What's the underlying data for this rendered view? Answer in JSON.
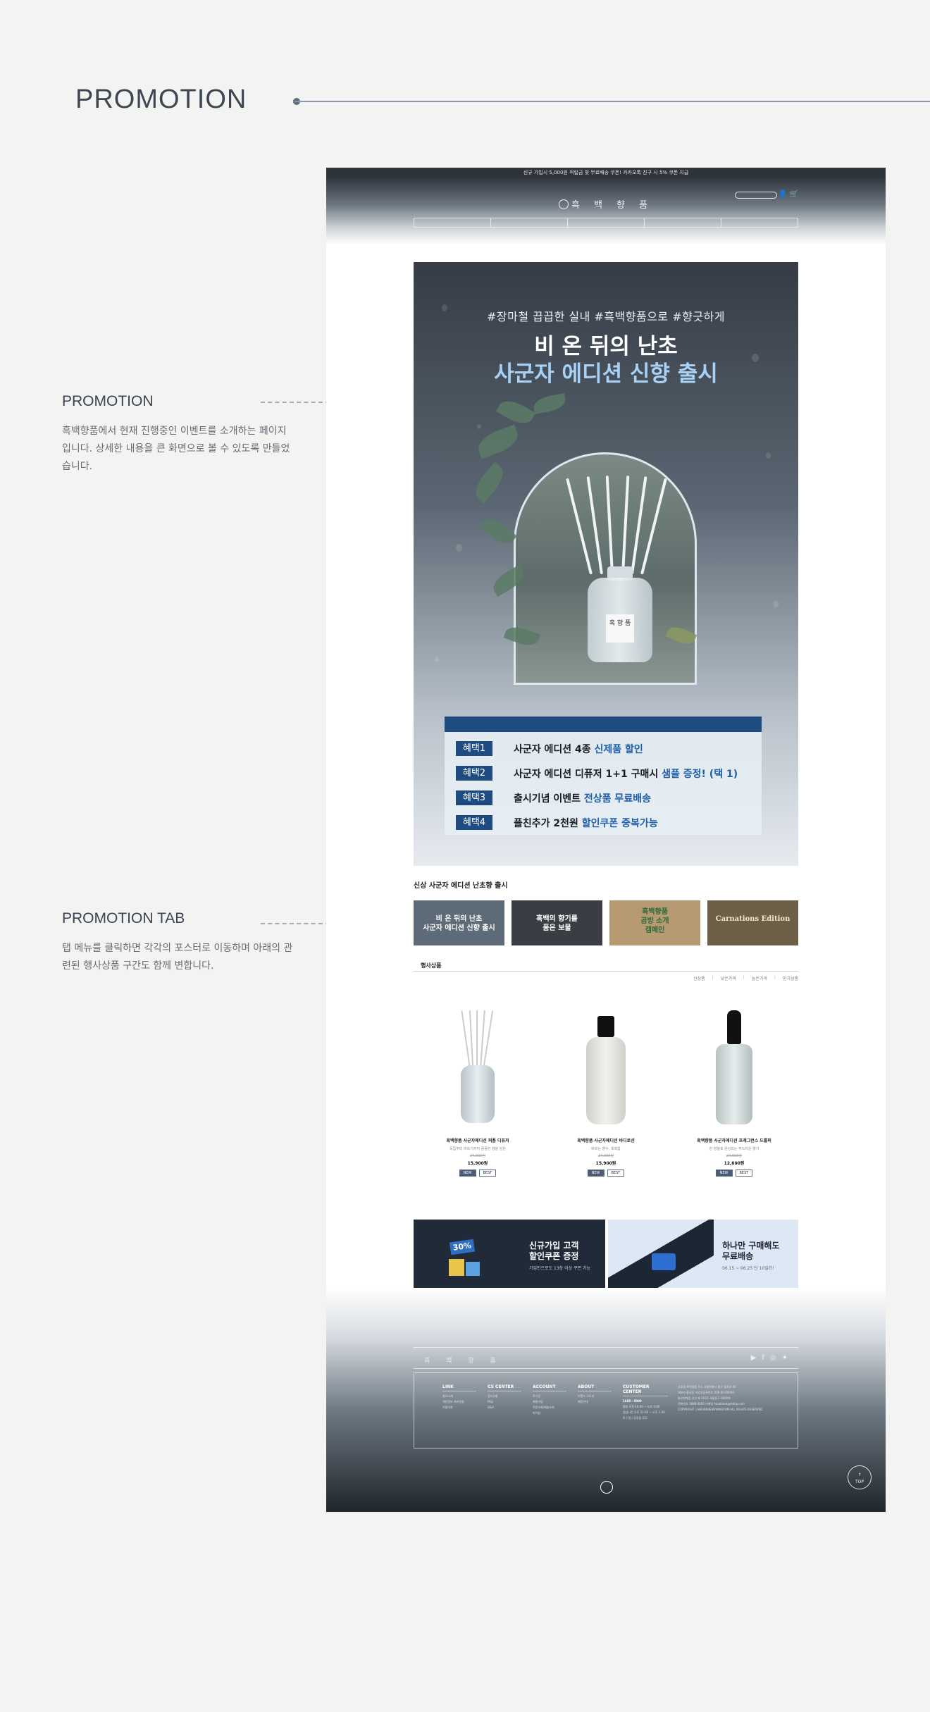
{
  "presentation": {
    "title": "PROMOTION",
    "notes": [
      {
        "heading": "PROMOTION",
        "text": "흑백향품에서 현재 진행중인 이벤트를 소개하는 페이지입니다. 상세한 내용을 큰 화면으로 볼 수 있도록 만들었습니다."
      },
      {
        "heading": "PROMOTION TAB",
        "text": "탭 메뉴를 클릭하면 각각의 포스터로 이동하며 아래의 관련된 행사상품 구간도 함께 변합니다."
      }
    ]
  },
  "site": {
    "topbar": "신규 가입시 5,000원 적립금 및 무료배송 쿠폰! 카카오톡 친구 시 5% 쿠폰 지급",
    "logo": "흑 백 향 품",
    "gnb": [
      "",
      "",
      "",
      "",
      ""
    ],
    "banner": {
      "hashtags": "#장마철 끕끕한 실내 #흑백향품으로 #향긋하게",
      "title1": "비 온 뒤의 난초",
      "title2": "사군자 에디션 신향 출시",
      "bottle_label": "흑 향 품",
      "benefits": [
        {
          "badge": "혜택1",
          "text": "사군자 에디션 4종 ",
          "highlight": "신제품 할인"
        },
        {
          "badge": "혜택2",
          "text": "사군자 에디션 디퓨저 1+1 구매시 ",
          "highlight": "샘플 증정! (택 1)"
        },
        {
          "badge": "혜택3",
          "text": "출시기념 이벤트 ",
          "highlight": "전상품 무료배송"
        },
        {
          "badge": "혜택4",
          "text": "플친추가 2천원 ",
          "highlight": "할인쿠폰 중복가능"
        }
      ]
    },
    "tab_section_title": "신상 사군자 에디션 난초향 출시",
    "tabs": [
      {
        "text": "비 온 뒤의 난초\n사군자 에디션 신향 출시",
        "color": "#5d6b78"
      },
      {
        "text": "흑백의 향기를\n품은 보물",
        "color": "#3a3e44"
      },
      {
        "text": "흑백향품\n곰방 소개\n캠페인",
        "color": "#b89a72"
      },
      {
        "text": "Carnations Edition",
        "color": "#6e6048"
      }
    ],
    "products_section": {
      "title": "행사상품",
      "filters": [
        "신상품",
        "낮은가격",
        "높은가격",
        "인기상품"
      ],
      "items": [
        {
          "name": "흑백향품 사군자에디션 퍼퓸 디퓨저",
          "desc": "독립부터 바르기까지 꼼꼼한 향을 담은",
          "orig_price": "24,000원",
          "price": "15,900원",
          "tags": [
            "NEW",
            "BEST"
          ]
        },
        {
          "name": "흑백향품 사군자에디션 바디로션",
          "desc": "바르는 향수, 촉촉함",
          "orig_price": "24,000원",
          "price": "15,900원",
          "tags": [
            "NEW",
            "BEST"
          ]
        },
        {
          "name": "흑백향품 사군자에디션 프래그런스 드롭퍼",
          "desc": "한 방울로 완성되는 부드러운 향기",
          "orig_price": "24,000원",
          "price": "12,600원",
          "tags": [
            "NEW",
            "BEST"
          ]
        }
      ]
    },
    "promos": [
      {
        "badge": "30%",
        "title": "신규가입 고객\n할인쿠폰 증정",
        "sub": "가입만으로도 13장 이상 쿠폰 가능"
      },
      {
        "title": "하나만 구매해도\n무료배송",
        "sub": "06.15 ~ 06.25 단 10일간!"
      }
    ],
    "footer": {
      "logo": "흑 백 향 품",
      "columns": [
        {
          "title": "LINK",
          "items": [
            "회사소개",
            "개인정보 처리방침",
            "이용약관"
          ]
        },
        {
          "title": "CS CENTER",
          "items": [
            "공지사항",
            "FAQ",
            "Q&A"
          ]
        },
        {
          "title": "ACCOUNT",
          "items": [
            "로그인",
            "회원가입",
            "주문조회/배송조회",
            "마이샵"
          ]
        },
        {
          "title": "ABOUT",
          "items": [
            "브랜드 스토리",
            "매장안내"
          ]
        },
        {
          "title": "CUSTOMER CENTER",
          "items": [
            "1688 - 0000",
            "평일 오전 10:00 ~ 오후 5:00",
            "점심시간 오후 12:00 ~ 오후 1:00",
            "토 / 일 / 공휴일 휴무"
          ]
        }
      ],
      "company": [
        "상호명 흑백향품 주소 서울특별시 중구 을지로 00",
        "대표자 홍길동 사업자등록번호 000-00-00000",
        "통신판매업 신고 제 2022-서울중구-0000호",
        "전화번호 1688-0000 이메일 heukbaek@hbhp.com",
        "COPYRIGHT ⓒHEUKBAEKHYANGPUM ALL RIGHTS RESERVED"
      ],
      "top_label": "TOP"
    }
  }
}
